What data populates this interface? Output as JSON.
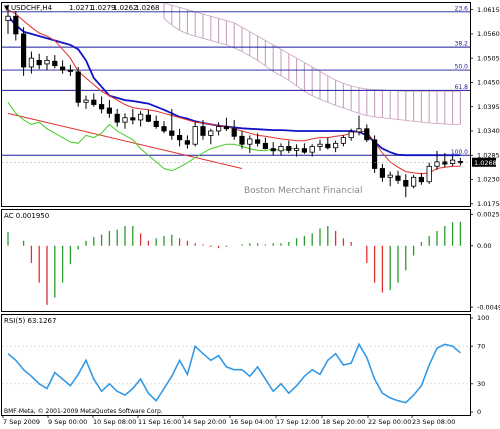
{
  "chart_data": [
    {
      "type": "candlestick",
      "panel": "price",
      "symbol_label": "USDCHF,H4",
      "ohlc_header": [
        "1.0271",
        "1.0279",
        "1.0262",
        "1.0268"
      ],
      "watermark": "Boston Merchant Financial",
      "current_price_label": "1.0268",
      "y_ticks": [
        "1.0615",
        "1.0560",
        "1.0505",
        "1.0450",
        "1.0395",
        "1.0340",
        "1.0285",
        "1.0230",
        "1.0175"
      ],
      "ylim": [
        1.017,
        1.063
      ],
      "fib_levels": [
        {
          "label": "23.6",
          "value": 1.061
        },
        {
          "label": "38.2",
          "value": 1.053
        },
        {
          "label": "50.0",
          "value": 1.0478
        },
        {
          "label": "61.8",
          "value": 1.0432
        },
        {
          "label": "100.0",
          "value": 1.0285
        }
      ],
      "candles": [
        {
          "o": 1.059,
          "h": 1.0626,
          "l": 1.056,
          "c": 1.06
        },
        {
          "o": 1.06,
          "h": 1.0612,
          "l": 1.0545,
          "c": 1.056
        },
        {
          "o": 1.056,
          "h": 1.0575,
          "l": 1.0465,
          "c": 1.0485
        },
        {
          "o": 1.0485,
          "h": 1.052,
          "l": 1.047,
          "c": 1.0505
        },
        {
          "o": 1.05,
          "h": 1.0515,
          "l": 1.048,
          "c": 1.049
        },
        {
          "o": 1.0492,
          "h": 1.051,
          "l": 1.0478,
          "c": 1.05
        },
        {
          "o": 1.0498,
          "h": 1.0512,
          "l": 1.0482,
          "c": 1.0488
        },
        {
          "o": 1.0485,
          "h": 1.05,
          "l": 1.047,
          "c": 1.0478
        },
        {
          "o": 1.0478,
          "h": 1.049,
          "l": 1.0465,
          "c": 1.0475
        },
        {
          "o": 1.0474,
          "h": 1.0485,
          "l": 1.0395,
          "c": 1.0405
        },
        {
          "o": 1.0405,
          "h": 1.042,
          "l": 1.039,
          "c": 1.041
        },
        {
          "o": 1.041,
          "h": 1.0425,
          "l": 1.0395,
          "c": 1.04
        },
        {
          "o": 1.04,
          "h": 1.0418,
          "l": 1.038,
          "c": 1.039
        },
        {
          "o": 1.0392,
          "h": 1.041,
          "l": 1.037,
          "c": 1.038
        },
        {
          "o": 1.0378,
          "h": 1.039,
          "l": 1.035,
          "c": 1.036
        },
        {
          "o": 1.036,
          "h": 1.038,
          "l": 1.0345,
          "c": 1.037
        },
        {
          "o": 1.037,
          "h": 1.039,
          "l": 1.0355,
          "c": 1.0365
        },
        {
          "o": 1.0365,
          "h": 1.0385,
          "l": 1.035,
          "c": 1.0378
        },
        {
          "o": 1.0376,
          "h": 1.0388,
          "l": 1.036,
          "c": 1.0362
        },
        {
          "o": 1.0362,
          "h": 1.0375,
          "l": 1.0345,
          "c": 1.035
        },
        {
          "o": 1.035,
          "h": 1.0362,
          "l": 1.0335,
          "c": 1.034
        },
        {
          "o": 1.034,
          "h": 1.039,
          "l": 1.032,
          "c": 1.033
        },
        {
          "o": 1.033,
          "h": 1.0345,
          "l": 1.0305,
          "c": 1.032
        },
        {
          "o": 1.0318,
          "h": 1.033,
          "l": 1.03,
          "c": 1.031
        },
        {
          "o": 1.031,
          "h": 1.036,
          "l": 1.0305,
          "c": 1.035
        },
        {
          "o": 1.035,
          "h": 1.0365,
          "l": 1.032,
          "c": 1.033
        },
        {
          "o": 1.033,
          "h": 1.0345,
          "l": 1.031,
          "c": 1.034
        },
        {
          "o": 1.034,
          "h": 1.036,
          "l": 1.033,
          "c": 1.035
        },
        {
          "o": 1.035,
          "h": 1.037,
          "l": 1.034,
          "c": 1.0345
        },
        {
          "o": 1.0345,
          "h": 1.0365,
          "l": 1.032,
          "c": 1.0328
        },
        {
          "o": 1.0328,
          "h": 1.034,
          "l": 1.03,
          "c": 1.031
        },
        {
          "o": 1.031,
          "h": 1.033,
          "l": 1.029,
          "c": 1.0322
        },
        {
          "o": 1.032,
          "h": 1.0335,
          "l": 1.0305,
          "c": 1.0312
        },
        {
          "o": 1.0312,
          "h": 1.0325,
          "l": 1.0298,
          "c": 1.03
        },
        {
          "o": 1.03,
          "h": 1.0315,
          "l": 1.0285,
          "c": 1.0295
        },
        {
          "o": 1.0295,
          "h": 1.0312,
          "l": 1.0285,
          "c": 1.0305
        },
        {
          "o": 1.0305,
          "h": 1.0318,
          "l": 1.029,
          "c": 1.0296
        },
        {
          "o": 1.0296,
          "h": 1.031,
          "l": 1.0282,
          "c": 1.03
        },
        {
          "o": 1.03,
          "h": 1.0312,
          "l": 1.0288,
          "c": 1.0292
        },
        {
          "o": 1.0292,
          "h": 1.031,
          "l": 1.0282,
          "c": 1.0305
        },
        {
          "o": 1.0305,
          "h": 1.032,
          "l": 1.0295,
          "c": 1.031
        },
        {
          "o": 1.031,
          "h": 1.0325,
          "l": 1.0298,
          "c": 1.0302
        },
        {
          "o": 1.0302,
          "h": 1.0318,
          "l": 1.0292,
          "c": 1.0312
        },
        {
          "o": 1.0312,
          "h": 1.033,
          "l": 1.0305,
          "c": 1.0325
        },
        {
          "o": 1.0325,
          "h": 1.0345,
          "l": 1.0318,
          "c": 1.0338
        },
        {
          "o": 1.0338,
          "h": 1.0375,
          "l": 1.033,
          "c": 1.0345
        },
        {
          "o": 1.0345,
          "h": 1.0355,
          "l": 1.0315,
          "c": 1.032
        },
        {
          "o": 1.032,
          "h": 1.033,
          "l": 1.0245,
          "c": 1.0255
        },
        {
          "o": 1.0255,
          "h": 1.0265,
          "l": 1.0225,
          "c": 1.0235
        },
        {
          "o": 1.0235,
          "h": 1.0248,
          "l": 1.0215,
          "c": 1.024
        },
        {
          "o": 1.0238,
          "h": 1.025,
          "l": 1.022,
          "c": 1.0228
        },
        {
          "o": 1.0228,
          "h": 1.0242,
          "l": 1.019,
          "c": 1.0215
        },
        {
          "o": 1.0215,
          "h": 1.024,
          "l": 1.021,
          "c": 1.0235
        },
        {
          "o": 1.0235,
          "h": 1.0245,
          "l": 1.0218,
          "c": 1.0225
        },
        {
          "o": 1.0225,
          "h": 1.0268,
          "l": 1.022,
          "c": 1.026
        },
        {
          "o": 1.026,
          "h": 1.0295,
          "l": 1.0252,
          "c": 1.027
        },
        {
          "o": 1.027,
          "h": 1.029,
          "l": 1.0258,
          "c": 1.0265
        },
        {
          "o": 1.0266,
          "h": 1.0285,
          "l": 1.026,
          "c": 1.0274
        },
        {
          "o": 1.0271,
          "h": 1.0279,
          "l": 1.0262,
          "c": 1.0268
        }
      ],
      "tenkan": [
        1.0615,
        1.0605,
        1.059,
        1.0575,
        1.0562,
        1.0555,
        1.0545,
        1.0525,
        1.0505,
        1.0475,
        1.046,
        1.0445,
        1.043,
        1.042,
        1.041,
        1.04,
        1.0393,
        1.039,
        1.0388,
        1.0385,
        1.038,
        1.0375,
        1.037,
        1.0365,
        1.036,
        1.0358,
        1.0355,
        1.0352,
        1.035,
        1.0345,
        1.034,
        1.0335,
        1.033,
        1.0328,
        1.0325,
        1.0322,
        1.032,
        1.0318,
        1.0318,
        1.0322,
        1.0325,
        1.0325,
        1.0328,
        1.033,
        1.0335,
        1.034,
        1.0338,
        1.0315,
        1.029,
        1.027,
        1.0258,
        1.0248,
        1.0245,
        1.0243,
        1.0245,
        1.0255,
        1.0258,
        1.026,
        1.026
      ],
      "kijun": [
        1.06,
        1.058,
        1.0565,
        1.056,
        1.0555,
        1.055,
        1.0545,
        1.054,
        1.0535,
        1.0525,
        1.05,
        1.046,
        1.044,
        1.042,
        1.0415,
        1.041,
        1.0408,
        1.0405,
        1.0402,
        1.0395,
        1.0388,
        1.038,
        1.0372,
        1.0368,
        1.0362,
        1.0358,
        1.0355,
        1.0352,
        1.035,
        1.0348,
        1.0346,
        1.0345,
        1.0344,
        1.0343,
        1.0342,
        1.0342,
        1.0341,
        1.034,
        1.034,
        1.034,
        1.034,
        1.034,
        1.034,
        1.034,
        1.034,
        1.0338,
        1.033,
        1.0315,
        1.03,
        1.0292,
        1.0286,
        1.0285,
        1.0285,
        1.0285,
        1.0285,
        1.0285,
        1.0285,
        1.0285,
        1.0285
      ],
      "chikou": [
        1.0405,
        1.038,
        1.0365,
        1.0355,
        1.036,
        1.0345,
        1.0335,
        1.0325,
        1.0315,
        1.0312,
        1.033,
        1.0325,
        1.0335,
        1.0355,
        1.034,
        1.033,
        1.032,
        1.03,
        1.0285,
        1.027,
        1.0255,
        1.025,
        1.0258,
        1.0268,
        1.028,
        1.029,
        1.03,
        1.0305,
        1.031,
        1.031,
        1.0305,
        1.03,
        1.0296,
        1.0295,
        1.03,
        1.0295,
        1.03,
        1.03
      ],
      "trendline": {
        "from": {
          "bar": 0,
          "value": 1.038
        },
        "to": {
          "bar": 30,
          "value": 1.0255
        }
      },
      "cloud_start_bar": 20,
      "cloud_top": [
        1.063,
        1.0625,
        1.062,
        1.0615,
        1.061,
        1.0605,
        1.06,
        1.0595,
        1.059,
        1.0585,
        1.0575,
        1.0565,
        1.0555,
        1.0545,
        1.0535,
        1.0525,
        1.0515,
        1.0505,
        1.0495,
        1.0485,
        1.0475,
        1.0465,
        1.0455,
        1.0448,
        1.0442,
        1.0438,
        1.0435,
        1.0434,
        1.0433,
        1.0432,
        1.0431,
        1.043,
        1.043,
        1.043,
        1.043,
        1.043,
        1.043,
        1.043,
        1.043,
        1.043,
        1.043,
        1.043,
        1.043,
        1.043,
        1.043,
        1.043,
        1.043,
        1.043,
        1.043
      ],
      "cloud_bottom": [
        1.0595,
        1.058,
        1.0568,
        1.056,
        1.0555,
        1.055,
        1.0545,
        1.054,
        1.0535,
        1.0528,
        1.052,
        1.051,
        1.05,
        1.0488,
        1.0475,
        1.0465,
        1.0455,
        1.0442,
        1.043,
        1.042,
        1.0412,
        1.0405,
        1.0398,
        1.0392,
        1.0386,
        1.038,
        1.0375,
        1.0372,
        1.037,
        1.0368,
        1.0366,
        1.0364,
        1.0362,
        1.036,
        1.0358,
        1.0357,
        1.0356,
        1.0355,
        1.0355,
        1.0355,
        1.0355,
        1.0355,
        1.0352,
        1.035,
        1.0348,
        1.0346,
        1.0345,
        1.0344,
        1.0343
      ]
    },
    {
      "type": "bar",
      "panel": "ac",
      "label": "AC 0.001950",
      "y_ticks": [
        "0.00255",
        "0.00",
        "-0.00498"
      ],
      "ylim": [
        -0.0053,
        0.0029
      ],
      "values": [
        0.0011,
        0.0,
        0.0004,
        -0.0014,
        -0.003,
        -0.0048,
        -0.0042,
        -0.003,
        -0.0015,
        -0.0003,
        0.0004,
        0.0007,
        0.0009,
        0.0012,
        0.0013,
        0.0016,
        0.0016,
        0.001,
        0.0004,
        0.0006,
        0.0008,
        0.0009,
        0.0006,
        0.0004,
        0.0002,
        0.0001,
        -0.0001,
        -0.0002,
        -0.0001,
        0.0,
        0.0001,
        0.0002,
        0.0002,
        0.0001,
        0.0002,
        0.0002,
        0.0003,
        0.0006,
        0.0008,
        0.001,
        0.0014,
        0.0016,
        0.0012,
        0.0006,
        0.0003,
        0.0,
        -0.0014,
        -0.003,
        -0.0038,
        -0.0036,
        -0.003,
        -0.002,
        -0.0008,
        0.0003,
        0.0008,
        0.0012,
        0.0016,
        0.0019,
        0.00195
      ]
    },
    {
      "type": "line",
      "panel": "rsi",
      "label": "RSI(5) 63.1267",
      "y_ticks": [
        "100",
        "70",
        "30",
        "0"
      ],
      "ylim": [
        0,
        100
      ],
      "values": [
        62,
        55,
        45,
        38,
        30,
        25,
        42,
        35,
        28,
        40,
        55,
        35,
        22,
        30,
        22,
        18,
        25,
        35,
        20,
        12,
        25,
        38,
        55,
        40,
        70,
        62,
        55,
        60,
        48,
        45,
        45,
        38,
        48,
        35,
        22,
        30,
        20,
        28,
        38,
        45,
        40,
        55,
        62,
        50,
        52,
        72,
        58,
        35,
        20,
        15,
        12,
        10,
        18,
        28,
        50,
        68,
        72,
        70,
        63
      ]
    }
  ],
  "time_axis": [
    "7 Sep 2009",
    "9 Sep 00:00",
    "10 Sep 08:00",
    "11 Sep 16:00",
    "14 Sep 20:00",
    "16 Sep 04:00",
    "17 Sep 12:00",
    "18 Sep 20:00",
    "22 Sep 00:00",
    "23 Sep 08:00"
  ],
  "copyright": "BMF-Meta, © 2001-2009 MetaQuotes Software Corp.",
  "colors": {
    "candle_up": "#ffffff",
    "candle_down": "#000000",
    "tenkan": "#e0302a",
    "kijun": "#1212c8",
    "chikou": "#44cc22",
    "trendline": "#e0302a",
    "cloud": "#c9a0c0",
    "fib": "#1b1b9e",
    "ac_up": "#2a9a2a",
    "ac_down": "#e03030",
    "rsi": "#3399e6",
    "grid": "#c8c8c8"
  }
}
